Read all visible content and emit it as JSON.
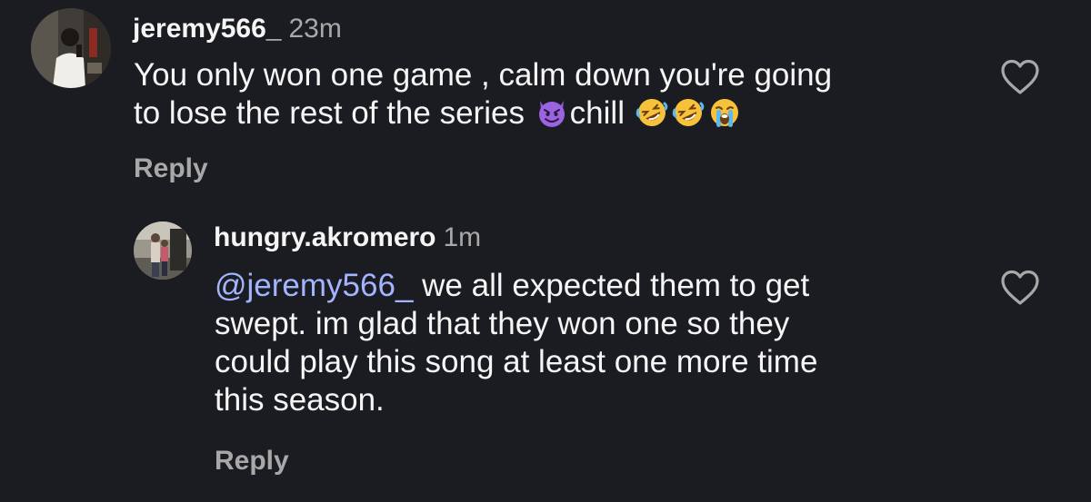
{
  "comments": [
    {
      "username": "jeremy566_",
      "timestamp": "23m",
      "text_line1": "You only won one game , calm down  you're going",
      "text_line2_before": "to lose the rest of the series ",
      "text_line2_middle": "chill ",
      "emojis": [
        "smiling-face-with-horns",
        "rolling-on-floor-laughing",
        "rolling-on-floor-laughing",
        "loudly-crying-face"
      ],
      "reply_label": "Reply"
    }
  ],
  "replies": [
    {
      "username": "hungry.akromero",
      "timestamp": "1m",
      "mention": "@jeremy566_",
      "text_line1_rest": " we all expected them to get",
      "text_line2": "swept. im glad that they won one so they",
      "text_line3": "could play this song at least one more time",
      "text_line4": "this season.",
      "reply_label": "Reply"
    }
  ],
  "colors": {
    "background": "#1b1c21",
    "text_primary": "#f5f5f5",
    "text_secondary": "#a8a8a8",
    "mention": "#a3b4ff"
  },
  "icons": {
    "like": "heart-outline-icon"
  }
}
